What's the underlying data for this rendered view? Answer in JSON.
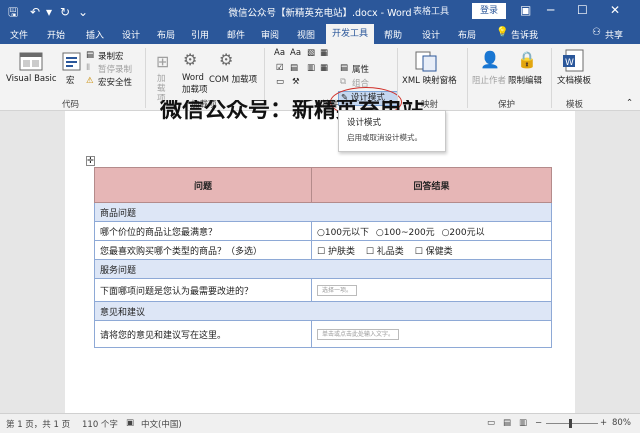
{
  "window": {
    "title": "微信公众号【新精英充电站】.docx  -  Word",
    "table_tools": "表格工具",
    "login": "登录",
    "share": "共享",
    "tell_me": "告诉我",
    "quick_access": [
      "save-icon",
      "undo-icon",
      "redo-icon",
      "more-icon"
    ]
  },
  "tabs": [
    "文件",
    "开始",
    "插入",
    "设计",
    "布局",
    "引用",
    "邮件",
    "审阅",
    "视图",
    "开发工具",
    "帮助",
    "设计",
    "布局"
  ],
  "active_tab": "开发工具",
  "ribbon": {
    "code": {
      "label": "代码",
      "visual_basic": "Visual Basic",
      "macro": "宏",
      "record_macro": "录制宏",
      "pause_recording": "暂停录制",
      "macro_security": "宏安全性"
    },
    "addins": {
      "label": "加载项",
      "addins": "加载项",
      "word_addins_1": "Word",
      "word_addins_2": "加载项",
      "com_addins": "COM 加载项"
    },
    "controls": {
      "label": "控件",
      "design_mode": "设计模式",
      "properties": "属性",
      "group": "组合"
    },
    "mapping": {
      "label": "映射",
      "xml_pane": "XML 映射窗格"
    },
    "protect": {
      "label": "保护",
      "block_authors": "阻止作者",
      "restrict_editing": "限制编辑"
    },
    "templates": {
      "label": "模板",
      "document_template": "文档模板"
    }
  },
  "tooltip": {
    "title": "设计模式",
    "desc": "启用或取消设计模式。"
  },
  "document": {
    "heading": "微信公众号：新精英充电站",
    "table": {
      "headers": [
        "问题",
        "回答结果"
      ],
      "rows": [
        {
          "section": "商品问题"
        },
        {
          "question": "哪个价位的商品让您最满意？",
          "options": [
            "100元以下",
            "100~200元",
            "200元以"
          ],
          "kind": "radio"
        },
        {
          "question": "您最喜欢购买哪个类型的商品？（多选）",
          "options": [
            "护肤类",
            "礼品类",
            "保健类"
          ],
          "kind": "check"
        },
        {
          "section": "服务问题"
        },
        {
          "question": "下面哪项问题是您认为最需要改进的？",
          "control": "选择一项。",
          "kind": "dropdown"
        },
        {
          "section": "意见和建议"
        },
        {
          "question": "请将您的意见和建议写在这里。",
          "control": "单击或点击此处输入文字。",
          "kind": "text"
        }
      ]
    }
  },
  "status": {
    "page": "第 1 页，共 1 页",
    "words": "110 个字",
    "language": "中文(中国)",
    "zoom": "80%"
  },
  "colors": {
    "word_blue": "#2b579a",
    "header_fill": "#e6b6b6",
    "section_fill": "#dde6f6",
    "highlight": "#d0302a"
  }
}
